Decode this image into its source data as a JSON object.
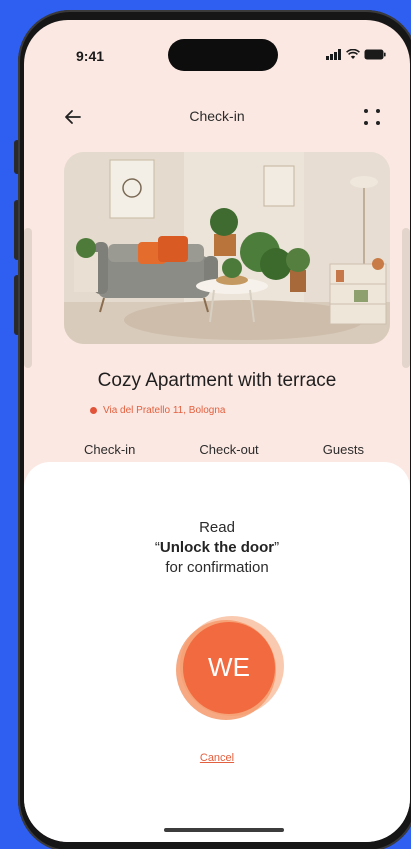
{
  "status_bar": {
    "time": "9:41"
  },
  "nav": {
    "title": "Check-in",
    "back_icon": "arrow-left-icon",
    "menu_icon": "four-dots-icon"
  },
  "listing": {
    "title": "Cozy Apartment with terrace",
    "address": "Via del Pratello 11, Bologna"
  },
  "tabs": [
    "Check-in",
    "Check-out",
    "Guests"
  ],
  "sheet": {
    "line1": "Read",
    "quote_open": "“",
    "phrase": "Unlock the door",
    "quote_close": "”",
    "line3": "for confirmation",
    "logo_text": "WE",
    "cancel_label": "Cancel"
  },
  "colors": {
    "background": "#2f5ff0",
    "screen": "#fce8e2",
    "accent": "#e2603f",
    "button_orange": "#f26a3f"
  }
}
